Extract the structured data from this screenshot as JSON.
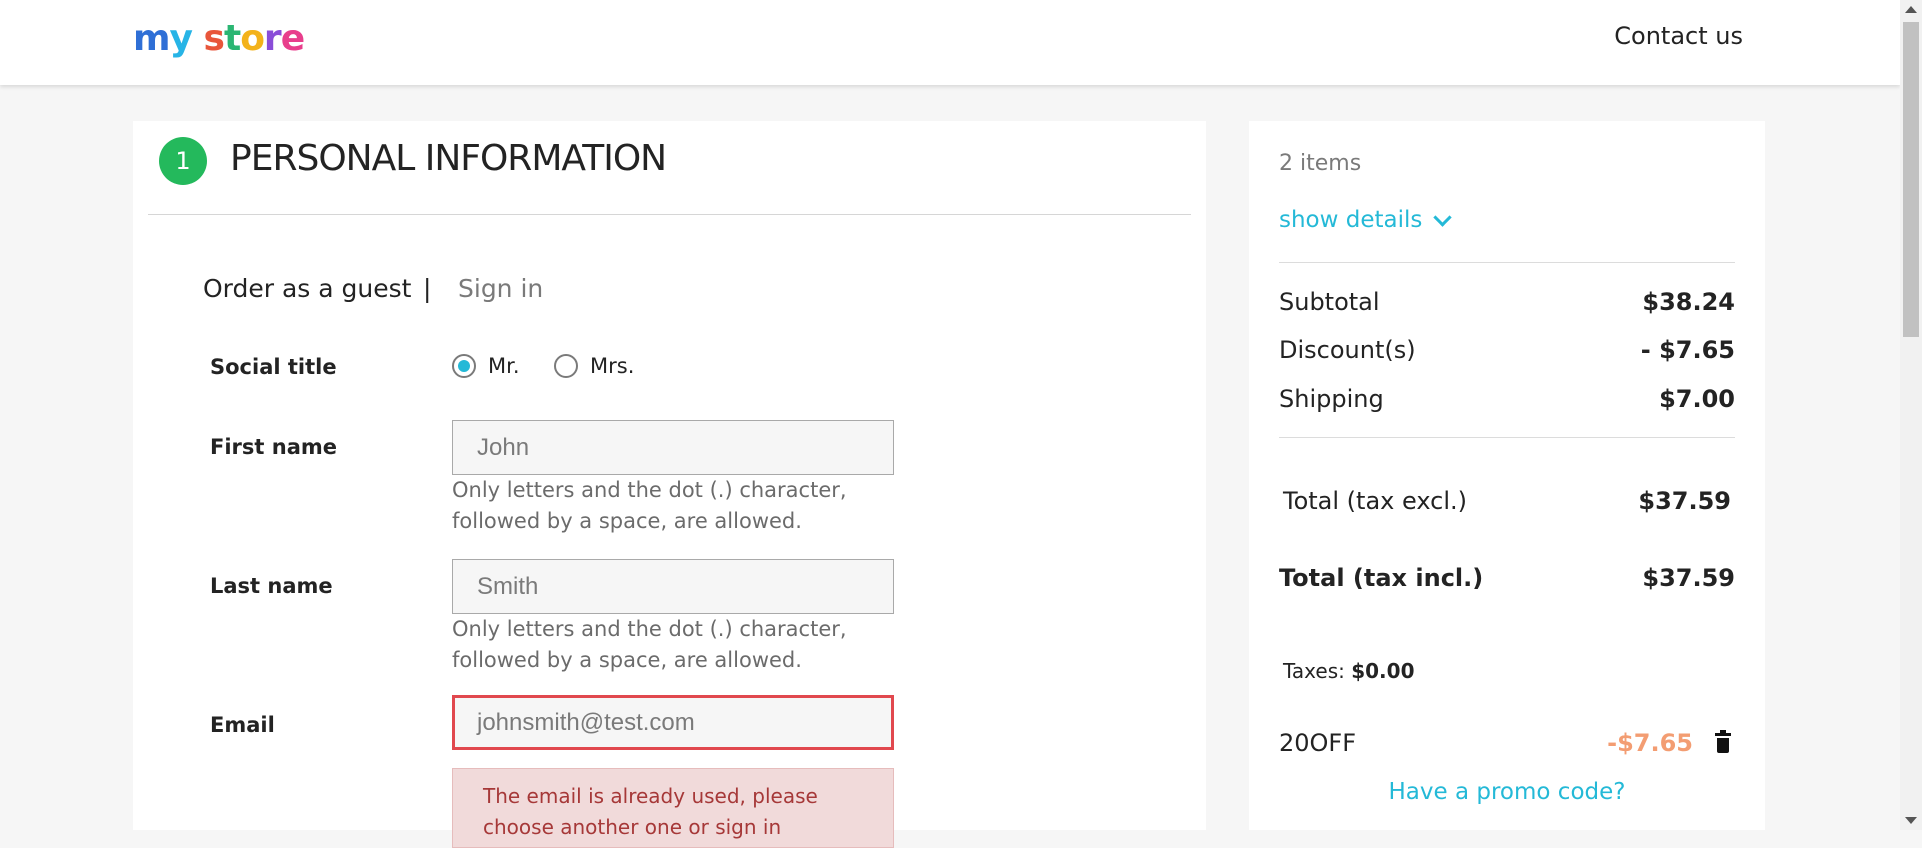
{
  "header": {
    "logo_text": "my store",
    "contact_label": "Contact us"
  },
  "checkout": {
    "step_number": "1",
    "step_title": "PERSONAL INFORMATION",
    "tabs": {
      "guest": "Order as a guest",
      "separator": "|",
      "signin": "Sign in"
    },
    "form": {
      "social_title_label": "Social title",
      "social_title_options": [
        {
          "label": "Mr.",
          "checked": true
        },
        {
          "label": "Mrs.",
          "checked": false
        }
      ],
      "first_name_label": "First name",
      "first_name_value": "John",
      "first_name_help": "Only letters and the dot (.) character, followed by a space, are allowed.",
      "last_name_label": "Last name",
      "last_name_value": "Smith",
      "last_name_help": "Only letters and the dot (.) character, followed by a space, are allowed.",
      "email_label": "Email",
      "email_value": "johnsmith@test.com",
      "email_error": "The email is already used, please choose another one or sign in"
    }
  },
  "summary": {
    "items_count": "2 items",
    "show_details": "show details",
    "subtotal_label": "Subtotal",
    "subtotal_value": "$38.24",
    "discount_label": "Discount(s)",
    "discount_value": "- $7.65",
    "shipping_label": "Shipping",
    "shipping_value": "$7.00",
    "total_excl_label": "Total (tax excl.)",
    "total_excl_value": "$37.59",
    "total_incl_label": "Total (tax incl.)",
    "total_incl_value": "$37.59",
    "taxes_label": "Taxes:",
    "taxes_value": "$0.00",
    "promo_code": "20OFF",
    "promo_value": "-$7.65",
    "have_promo": "Have a promo code?"
  },
  "colors": {
    "accent": "#24b9d7",
    "step_badge": "#24b95c",
    "error_border": "#e1484e",
    "promo_discount": "#f39d72"
  },
  "icons": [
    "chevron-down-icon",
    "trash-icon",
    "radio-checked-icon"
  ]
}
